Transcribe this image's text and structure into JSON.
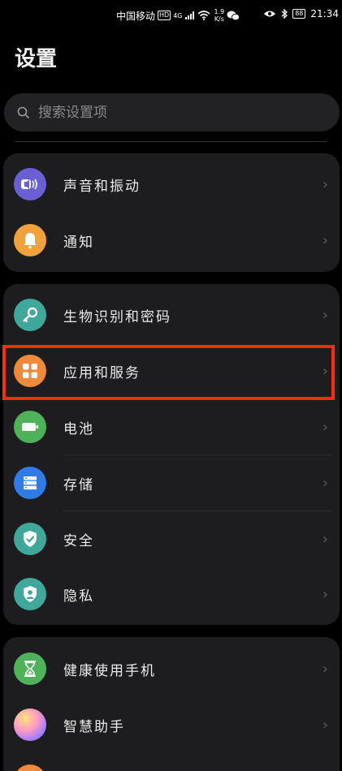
{
  "status_bar": {
    "carrier": "中国移动",
    "hd": "HD",
    "signal_label": "4G",
    "speed_value": "1.9",
    "speed_unit": "K/s",
    "battery": "88",
    "time": "21:34"
  },
  "page": {
    "title": "设置"
  },
  "search": {
    "placeholder": "搜索设置项"
  },
  "groups": [
    {
      "items": [
        {
          "label": "声音和振动",
          "icon": "speaker-icon",
          "color": "#6b5fd6"
        },
        {
          "label": "通知",
          "icon": "bell-icon",
          "color": "#f0a13a"
        }
      ]
    },
    {
      "items": [
        {
          "label": "生物识别和密码",
          "icon": "key-icon",
          "color": "#3fa89a"
        },
        {
          "label": "应用和服务",
          "icon": "apps-grid-icon",
          "color": "#ef8a3a"
        },
        {
          "label": "电池",
          "icon": "battery-icon",
          "color": "#4db25a"
        },
        {
          "label": "存储",
          "icon": "storage-icon",
          "color": "#2f7be8"
        },
        {
          "label": "安全",
          "icon": "shield-check-icon",
          "color": "#3fa89a"
        },
        {
          "label": "隐私",
          "icon": "privacy-shield-icon",
          "color": "#3fa89a"
        }
      ]
    },
    {
      "items": [
        {
          "label": "健康使用手机",
          "icon": "hourglass-icon",
          "color": "#4db25a"
        },
        {
          "label": "智慧助手",
          "icon": "assistant-orb-icon",
          "color": "#c98adf"
        }
      ]
    }
  ],
  "chevron_glyph": "›"
}
